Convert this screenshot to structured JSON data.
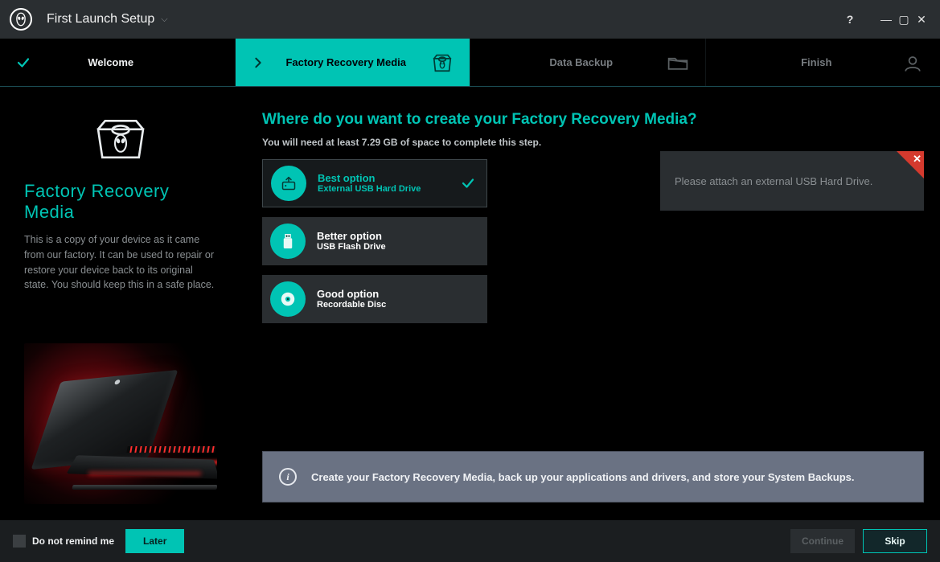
{
  "app": {
    "title": "First Launch Setup"
  },
  "steps": [
    {
      "label": "Welcome"
    },
    {
      "label": "Factory Recovery Media"
    },
    {
      "label": "Data Backup"
    },
    {
      "label": "Finish"
    }
  ],
  "sidebar": {
    "heading": "Factory Recovery Media",
    "description": "This is a copy of your device as it came from our factory. It can be used to repair or restore your device back to its original state. You should keep this in a safe place."
  },
  "content": {
    "question": "Where do you want to create your Factory Recovery Media?",
    "requirement": "You will need at least 7.29 GB of space to complete this step.",
    "options": [
      {
        "title": "Best option",
        "sub": "External USB Hard Drive",
        "selected": true
      },
      {
        "title": "Better option",
        "sub": "USB Flash Drive",
        "selected": false
      },
      {
        "title": "Good option",
        "sub": "Recordable Disc",
        "selected": false
      }
    ],
    "alert": "Please attach an external USB Hard Drive.",
    "info": "Create your Factory Recovery Media, back up your applications and drivers, and store your System Backups."
  },
  "footer": {
    "remind": "Do not remind me",
    "later": "Later",
    "continue": "Continue",
    "skip": "Skip"
  }
}
